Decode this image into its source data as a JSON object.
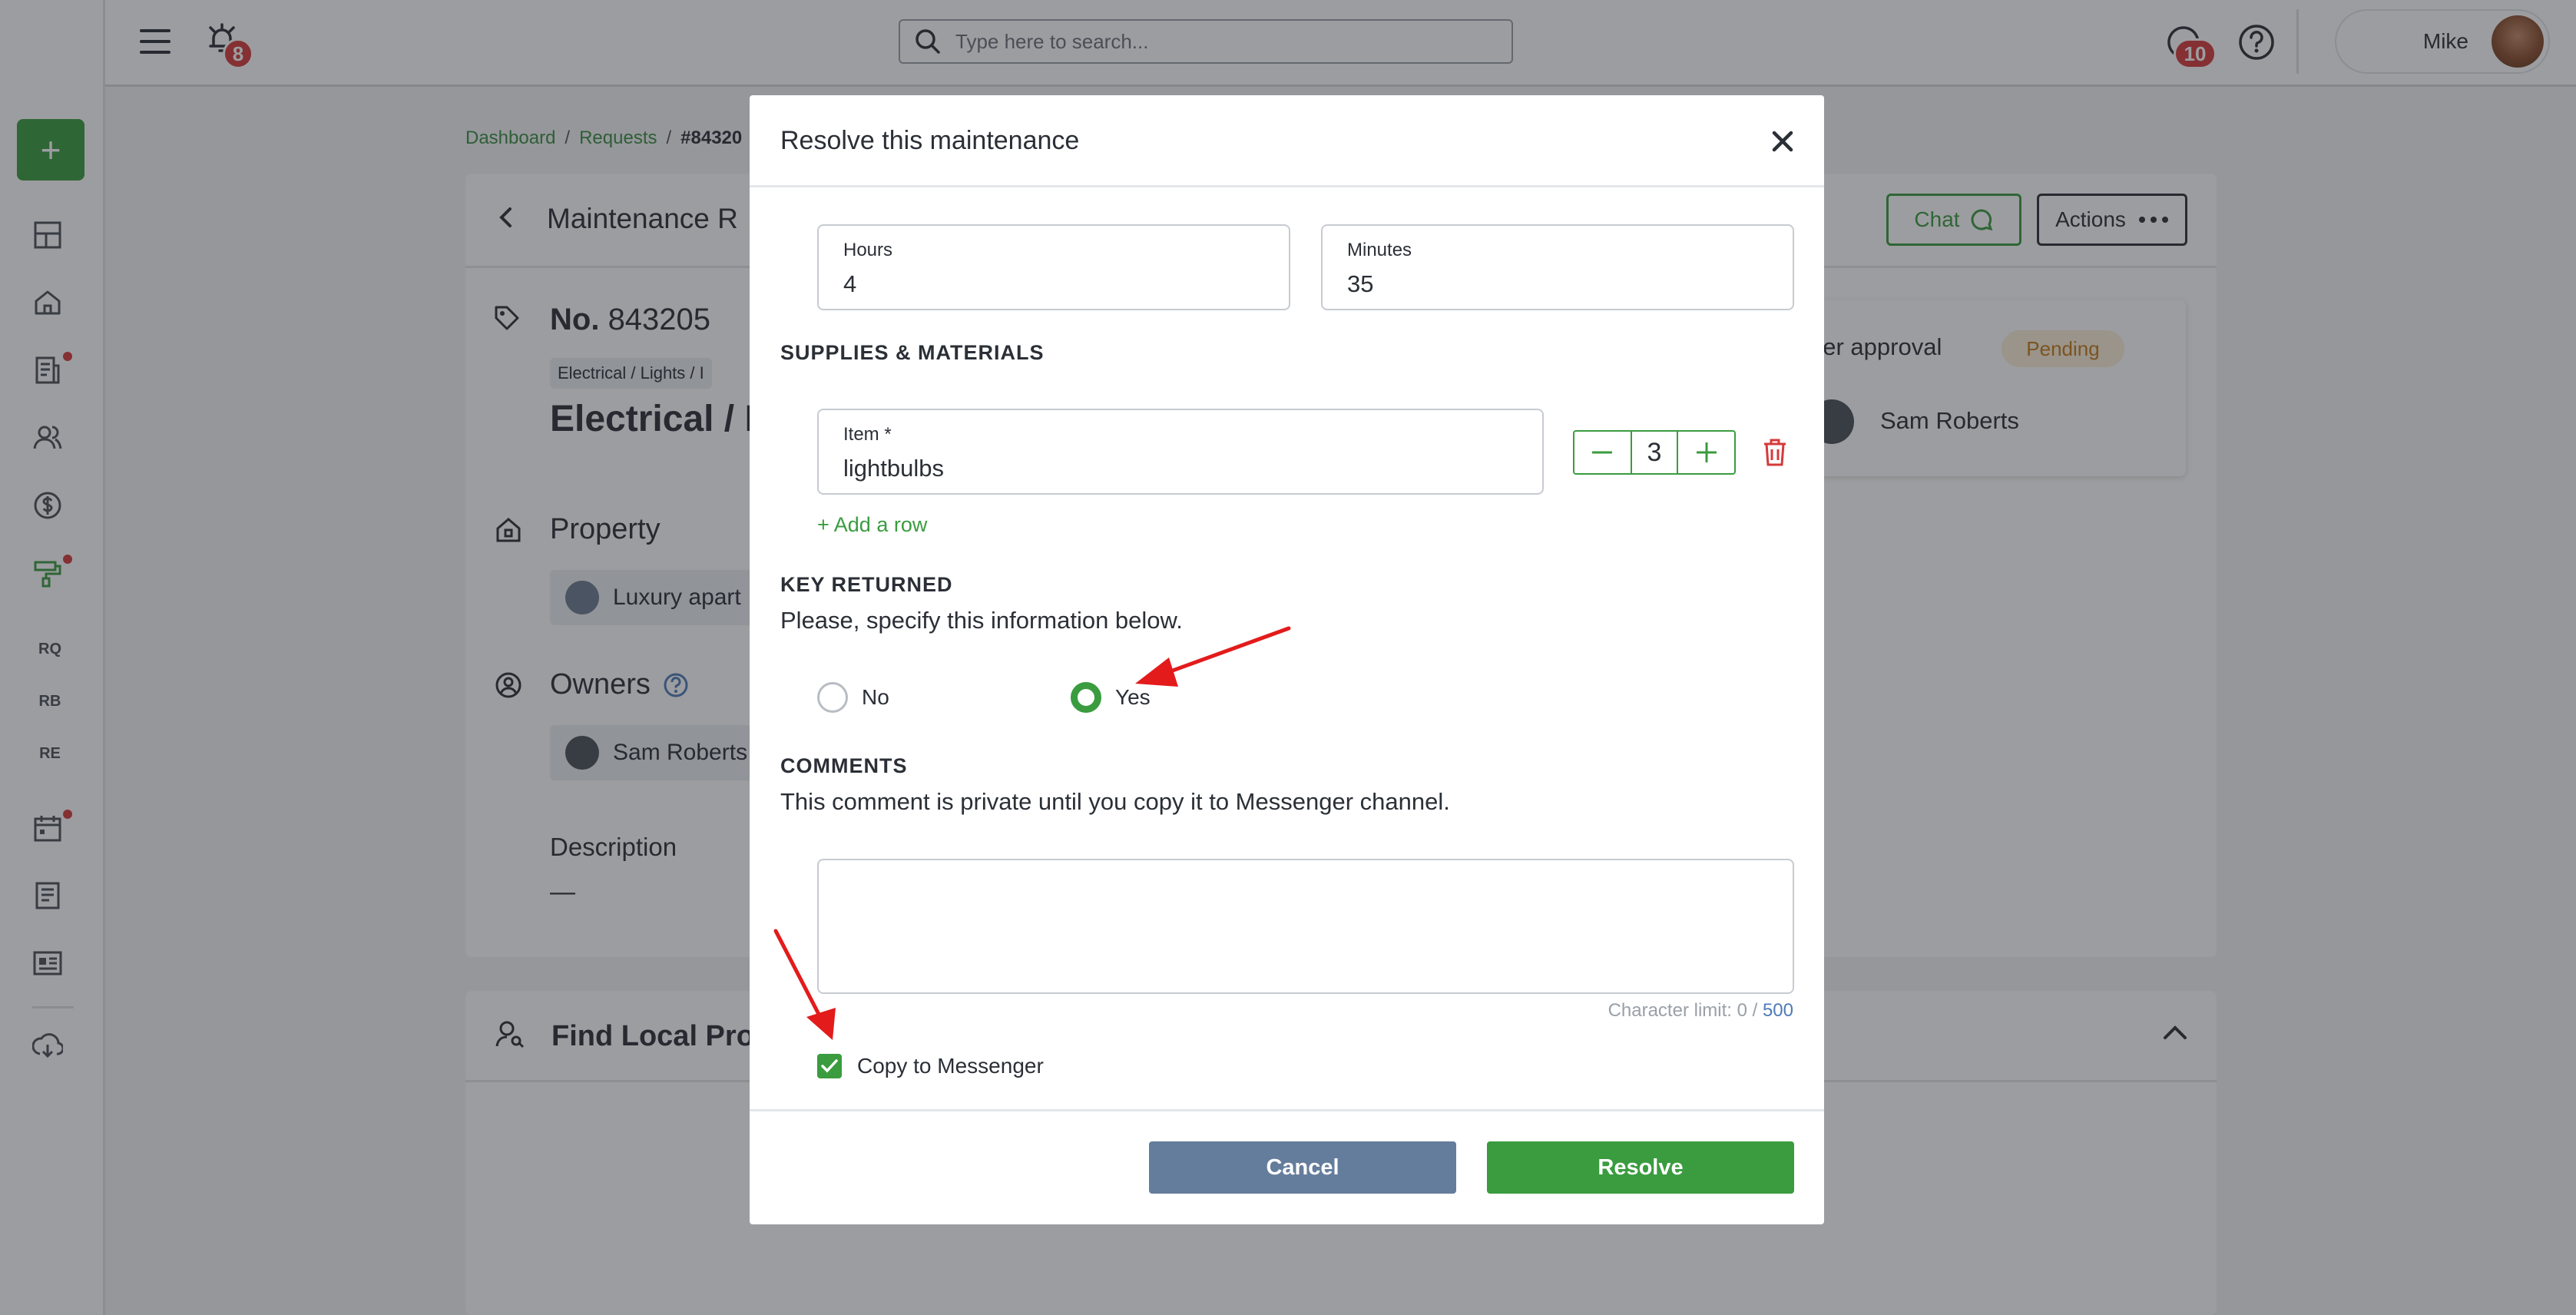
{
  "topbar": {
    "search_placeholder": "Type here to search...",
    "notifications_count": "8",
    "messages_count": "10",
    "user_name": "Mike"
  },
  "sidebar": {
    "add_label": "+",
    "items": [
      "dashboard",
      "home",
      "reports",
      "people",
      "finance",
      "maintenance",
      "RQ",
      "RB",
      "RE",
      "calendar",
      "documents",
      "listings",
      "download"
    ],
    "text_items": [
      "RQ",
      "RB",
      "RE"
    ]
  },
  "breadcrumb": {
    "items": [
      "Dashboard",
      "Requests",
      "#84320"
    ]
  },
  "background": {
    "header_title": "Maintenance R",
    "chat_label": "Chat",
    "actions_label": "Actions",
    "request_no_label": "No.",
    "request_no": "843205",
    "category_tag": "Electrical / Lights / I",
    "category_title": "Electrical / L",
    "property_heading": "Property",
    "property_value": "Luxury apart",
    "owners_heading": "Owners",
    "owner_name": "Sam Roberts",
    "description_heading": "Description",
    "description_value": "—",
    "approval_heading": "ner approval",
    "approval_status": "Pending",
    "approver_name": "Sam Roberts",
    "find_local_heading": "Find Local Prof"
  },
  "modal": {
    "title": "Resolve this maintenance",
    "hours_label": "Hours",
    "hours_value": "4",
    "minutes_label": "Minutes",
    "minutes_value": "35",
    "supplies_heading": "SUPPLIES & MATERIALS",
    "item_label": "Item *",
    "item_value": "lightbulbs",
    "quantity": "3",
    "add_row": "+ Add a row",
    "key_heading": "KEY RETURNED",
    "key_instruction": "Please, specify this information below.",
    "option_no": "No",
    "option_yes": "Yes",
    "key_returned_selected": "Yes",
    "comments_heading": "COMMENTS",
    "comments_note": "This comment is private until you copy it to Messenger channel.",
    "comment_value": "",
    "char_limit_label": "Character limit: 0 /",
    "char_limit_max": "500",
    "copy_label": "Copy to Messenger",
    "copy_checked": true,
    "cancel_label": "Cancel",
    "resolve_label": "Resolve"
  },
  "colors": {
    "brand_green": "#3a9c3f",
    "cancel_blue": "#657d9c",
    "alert_red": "#d6393a",
    "annotation_red": "#e31b1b"
  }
}
